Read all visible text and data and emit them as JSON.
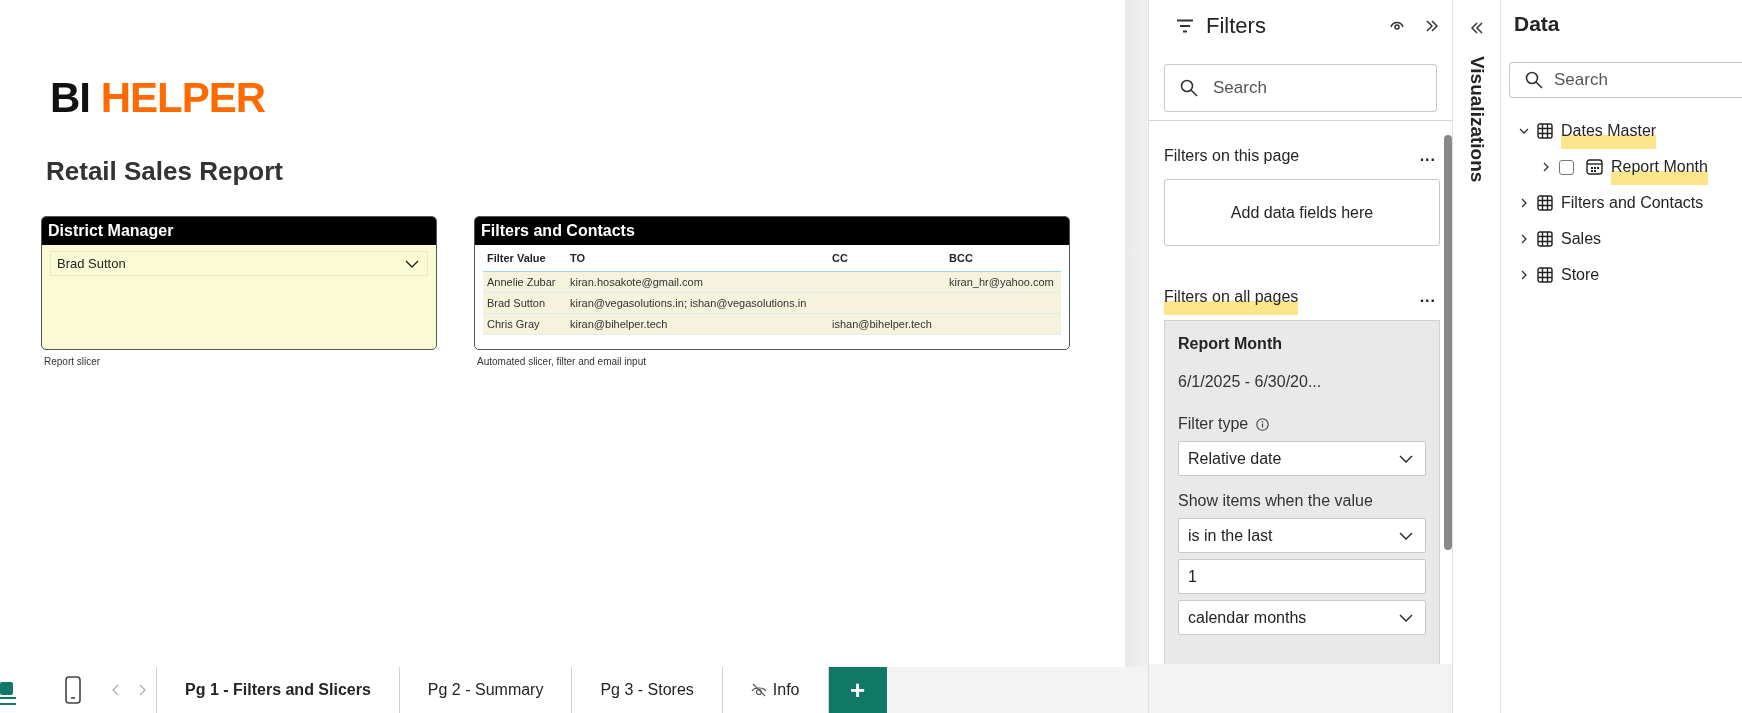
{
  "logo": {
    "part_1": "BI",
    "part_2": "HELPER"
  },
  "report_title": "Retail Sales Report",
  "visuals": [
    {
      "kind": "slicer",
      "title": "District Manager",
      "value": "Brad Sutton",
      "caption": "Report slicer"
    },
    {
      "kind": "table",
      "title": "Filters and Contacts",
      "columns": [
        "Filter Value",
        "TO",
        "CC",
        "BCC"
      ],
      "rows": [
        [
          "Annelie Zubar",
          "kiran.hosakote@gmail.com",
          null,
          "kiran_hr@yahoo.com"
        ],
        [
          "Brad Sutton",
          "kiran@vegasolutions.in; ishan@vegasolutions.in",
          null,
          null
        ],
        [
          "Chris Gray",
          "kiran@bihelper.tech",
          "ishan@bihelper.tech",
          null
        ]
      ],
      "caption": "Automated slicer, filter and email input"
    }
  ],
  "view_modes": [
    {
      "kind": "desktop",
      "selected": true
    },
    {
      "kind": "mobile",
      "selected": false
    }
  ],
  "page_tabs": [
    {
      "label": "Pg 1 - Filters and Slicers",
      "selected": true,
      "hidden": false
    },
    {
      "label": "Pg 2 - Summary",
      "selected": false,
      "hidden": false
    },
    {
      "label": "Pg 3 - Stores",
      "selected": false,
      "hidden": false
    },
    {
      "label": "Info",
      "selected": false,
      "hidden": true
    }
  ],
  "add_page": "+",
  "filters_pane": {
    "title": "Filters",
    "search": {
      "placeholder": "Search"
    },
    "page_section": {
      "title": "Filters on this page",
      "more": "...",
      "drop_zone": "Add data fields here"
    },
    "all_pages_section": {
      "title": "Filters on all pages",
      "more": "...",
      "highlighted": true
    },
    "filter_card": {
      "field": "Report Month",
      "summary": "6/1/2025 - 6/30/20...",
      "filter_type_label": "Filter type",
      "filter_type": "Relative date",
      "condition_label": "Show items when the value",
      "operator": "is in the last",
      "amount": "1",
      "unit": "calendar months"
    }
  },
  "visualizations_pane": {
    "title": "Visualizations"
  },
  "data_pane": {
    "title": "Data",
    "search": {
      "placeholder": "Search"
    },
    "tree": [
      {
        "label": "Dates Master",
        "kind": "table",
        "expanded": true,
        "highlighted": true,
        "children": [
          {
            "label": "Report Month",
            "kind": "date_field",
            "expanded": false,
            "checked": false,
            "highlighted": true
          }
        ]
      },
      {
        "label": "Filters and Contacts",
        "kind": "table",
        "expanded": false,
        "highlighted": false
      },
      {
        "label": "Sales",
        "kind": "table",
        "expanded": false,
        "highlighted": false
      },
      {
        "label": "Store",
        "kind": "table",
        "expanded": false,
        "highlighted": false
      }
    ]
  }
}
